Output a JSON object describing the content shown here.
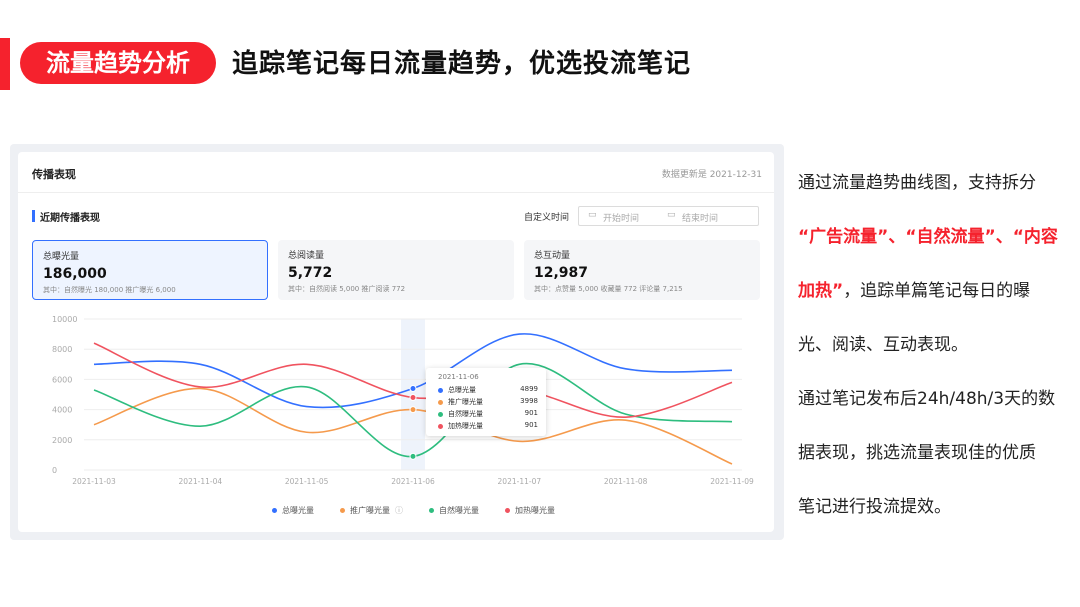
{
  "header": {
    "pill": "流量趋势分析",
    "headline": "追踪笔记每日流量趋势，优选投流笔记"
  },
  "card": {
    "title": "传播表现",
    "updated": "数据更新是 2021-12-31",
    "section_title": "近期传播表现",
    "custom_time_label": "自定义时间",
    "start_placeholder": "开始时间",
    "end_placeholder": "结束时间"
  },
  "metrics": [
    {
      "label": "总曝光量",
      "value": "186,000",
      "sub": "其中：自然曝光 180,000   推广曝光 6,000"
    },
    {
      "label": "总阅读量",
      "value": "5,772",
      "sub": "其中：自然阅读 5,000   推广阅读 772"
    },
    {
      "label": "总互动量",
      "value": "12,987",
      "sub": "其中：点赞量 5,000   收藏量 772   评论量 7,215"
    }
  ],
  "tooltip": {
    "date": "2021-11-06",
    "rows": [
      {
        "name": "总曝光量",
        "value": "4899",
        "color": "#3370ff"
      },
      {
        "name": "推广曝光量",
        "value": "3998",
        "color": "#f59a4c"
      },
      {
        "name": "自然曝光量",
        "value": "901",
        "color": "#2ebd7f"
      },
      {
        "name": "加热曝光量",
        "value": "901",
        "color": "#f0535f"
      }
    ]
  },
  "chart_data": {
    "type": "line",
    "categories": [
      "2021-11-03",
      "2021-11-04",
      "2021-11-05",
      "2021-11-06",
      "2021-11-07",
      "2021-11-08",
      "2021-11-09"
    ],
    "ylim": [
      0,
      10000
    ],
    "yticks": [
      "0",
      "2000",
      "4000",
      "6000",
      "8000",
      "10000"
    ],
    "grid": true,
    "legend_position": "bottom",
    "highlight_category": "2021-11-06",
    "series": [
      {
        "name": "总曝光量",
        "color": "#3370ff",
        "values": [
          7000,
          7000,
          4200,
          5400,
          9000,
          6700,
          6600
        ]
      },
      {
        "name": "推广曝光量",
        "color": "#f59a4c",
        "values": [
          3000,
          5400,
          2500,
          4000,
          1900,
          3300,
          400
        ]
      },
      {
        "name": "自然曝光量",
        "color": "#2ebd7f",
        "values": [
          5300,
          2900,
          5500,
          900,
          7000,
          3700,
          3200
        ]
      },
      {
        "name": "加热曝光量",
        "color": "#f0535f",
        "values": [
          8400,
          5500,
          7000,
          4800,
          5300,
          3500,
          5800
        ]
      }
    ]
  },
  "side": {
    "line1": "通过流量趋势曲线图，支持拆分",
    "red1": "“广告流量”、“自然流量”、“内容",
    "red2": "加热”",
    "line3": "，追踪单篇笔记每日的曝",
    "line4": "光、阅读、互动表现。",
    "line5": "通过笔记发布后24h/48h/3天的数",
    "line6": "据表现，挑选流量表现佳的优质",
    "line7": "笔记进行投流提效。"
  }
}
